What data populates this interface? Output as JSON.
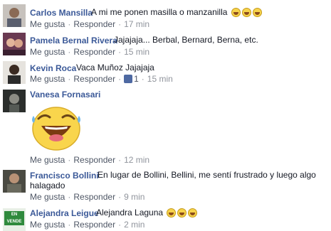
{
  "comments": [
    {
      "name": "Carlos Mansilla",
      "text": "A mi me ponen masilla o manzanilla",
      "like": "Me gusta",
      "reply": "Responder",
      "time": "17 min"
    },
    {
      "name": "Pamela Bernal Rivera",
      "text": "Jajajaja... Berbal, Bernard, Berna, etc.",
      "like": "Me gusta",
      "reply": "Responder",
      "time": "15 min"
    },
    {
      "name": "Kevin Roca",
      "text": "Vaca Muñoz Jajajaja",
      "like": "Me gusta",
      "reply": "Responder",
      "likes_count": "1",
      "time": "15 min"
    },
    {
      "name": "Vanesa Fornasari",
      "text": "",
      "like": "Me gusta",
      "reply": "Responder",
      "time": "12 min"
    },
    {
      "name": "Francisco Bollini",
      "text_line1": "En lugar de Bollini, Bellini, me sentí frustrado y luego algo",
      "text_line2": "halagado",
      "like": "Me gusta",
      "reply": "Responder",
      "time": "9 min"
    },
    {
      "name": "Alejandra Leigue",
      "text": "Alejandra Laguna",
      "avatar_text": "EN VENDE",
      "like": "Me gusta",
      "reply": "Responder",
      "time": "2 min"
    }
  ],
  "icons": {
    "emoji": "laughing-tears-emoji-icon",
    "like": "thumbs-up-icon"
  },
  "colors": {
    "name": "#3b5998",
    "meta": "#90949c",
    "like_badge": "#4e69a2",
    "emoji": "#f7d34b"
  }
}
